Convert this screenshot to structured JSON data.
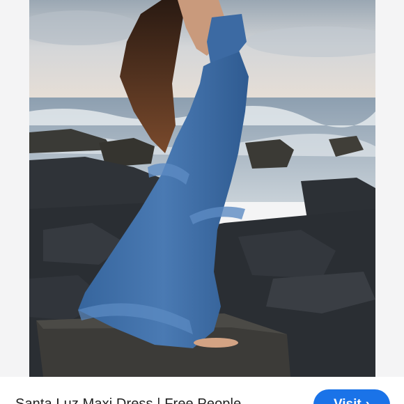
{
  "image": {
    "alt_icon": "photo-icon"
  },
  "footer": {
    "title": "Santa Luz Maxi Dress | Free People",
    "visit_label": "Visit",
    "visit_arrow": "›"
  },
  "colors": {
    "accent": "#1a73e8",
    "dress": "#3f6ea8",
    "sky": "#c9d3dc",
    "rock": "#2b2f35"
  }
}
